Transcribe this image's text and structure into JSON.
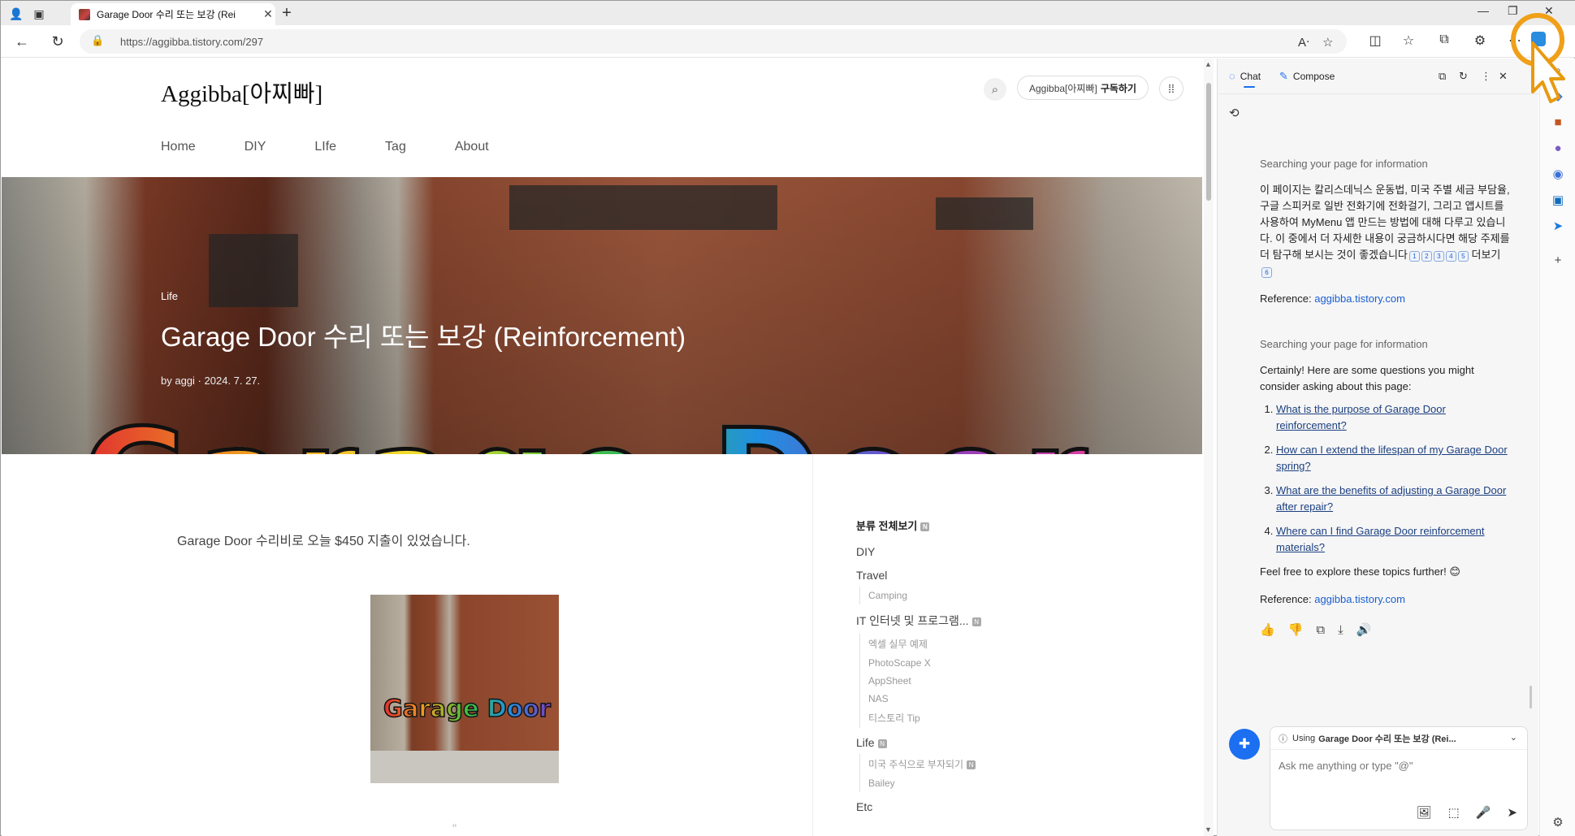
{
  "browser": {
    "tab_title": "Garage Door 수리 또는 보강 (Rei",
    "url": "https://aggibba.tistory.com/297",
    "window": {
      "minimize": "—",
      "restore": "❐",
      "close": "✕"
    }
  },
  "blog": {
    "logo": "Aggibba[아찌빠]",
    "subscribe_prefix": "Aggibba[아찌빠]",
    "subscribe_label": "구독하기",
    "menu": [
      "Home",
      "DIY",
      "LIfe",
      "Tag",
      "About"
    ]
  },
  "post": {
    "category": "Life",
    "title": "Garage Door 수리 또는 보강 (Reinforcement)",
    "author": "by aggi",
    "date": "2024. 7. 27.",
    "hero_text": "Garage Door",
    "body": "Garage Door 수리비로 오늘 $450 지출이 있었습니다.",
    "thumb_text": "Garage Door",
    "quote_mark": "“"
  },
  "categories": {
    "header": "분류 전체보기",
    "items": [
      {
        "name": "DIY",
        "sub": []
      },
      {
        "name": "Travel",
        "sub": [
          "Camping"
        ]
      },
      {
        "name": "IT 인터넷 및 프로그램...",
        "badge": "N",
        "sub": [
          "엑셀 실무 예제",
          "PhotoScape X",
          "AppSheet",
          "NAS",
          "티스토리 Tip"
        ]
      },
      {
        "name": "Life",
        "badge": "N",
        "sub": [
          "미국 주식으로 부자되기",
          "Bailey"
        ]
      },
      {
        "name": "Etc",
        "sub": []
      }
    ],
    "badge_text": "N"
  },
  "copilot": {
    "tab_chat": "Chat",
    "tab_compose": "Compose",
    "searching": "Searching your page for information",
    "answer1": "이 페이지는 칼리스데닉스 운동법, 미국 주별 세금 부담율, 구글 스피커로 일반 전화기에 전화걸기, 그리고 앱시트를 사용하여 MyMenu 앱 만드는 방법에 대해 다루고 있습니다. 이 중에서 더 자세한 내용이 궁금하시다면 해당 주제를 더 탐구해 보시는 것이 좋겠습니다",
    "citations": [
      "1",
      "2",
      "3",
      "4",
      "5"
    ],
    "more_label": "더보기",
    "citation_more": "6",
    "reference_label": "Reference:",
    "reference_link": "aggibba.tistory.com",
    "searching2": "Searching your page for information",
    "answer2_intro": "Certainly! Here are some questions you might consider asking about this page:",
    "questions": [
      "What is the purpose of Garage Door reinforcement?",
      "How can I extend the lifespan of my Garage Door spring?",
      "What are the benefits of adjusting a Garage Door after repair?",
      "Where can I find Garage Door reinforcement materials?"
    ],
    "answer2_outro": "Feel free to explore these topics further! 😊",
    "reference2_link": "aggibba.tistory.com",
    "context_prefix": "Using",
    "context_title": "Garage Door 수리 또는 보강 (Rei...",
    "input_placeholder": "Ask me anything or type \"@\""
  },
  "colors": {
    "accent": "#1b6ff0",
    "link": "#1b5fd0"
  }
}
